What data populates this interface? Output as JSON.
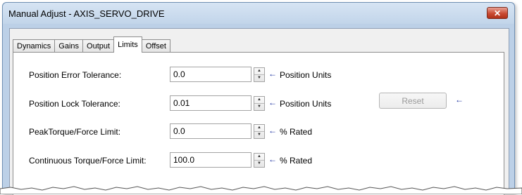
{
  "window": {
    "title": "Manual Adjust - AXIS_SERVO_DRIVE",
    "close_icon": "close-icon"
  },
  "tabs": [
    {
      "label": "Dynamics",
      "active": false
    },
    {
      "label": "Gains",
      "active": false
    },
    {
      "label": "Output",
      "active": false
    },
    {
      "label": "Limits",
      "active": true
    },
    {
      "label": "Offset",
      "active": false
    }
  ],
  "limits": {
    "rows": [
      {
        "label": "Position Error Tolerance:",
        "value": "0.0",
        "units": "Position Units"
      },
      {
        "label": "Position Lock Tolerance:",
        "value": "0.01",
        "units": "Position Units"
      },
      {
        "label": "PeakTorque/Force Limit:",
        "value": "0.0",
        "units": "% Rated"
      },
      {
        "label": "Continuous Torque/Force Limit:",
        "value": "100.0",
        "units": "% Rated"
      }
    ],
    "reset_label": "Reset",
    "arrow_glyph": "←",
    "accent_color": "#1a2f9e"
  }
}
